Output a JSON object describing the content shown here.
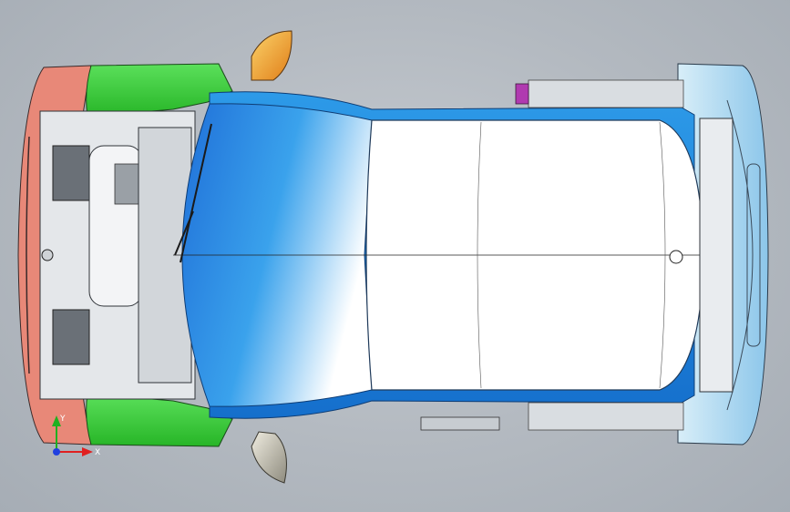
{
  "viewport": {
    "view": "top",
    "background_color": "#b3b9c0"
  },
  "model": {
    "parts": [
      {
        "part": "front-bumper",
        "color": "#e88878"
      },
      {
        "part": "front-fender-left",
        "color": "#3fcf3f"
      },
      {
        "part": "front-fender-right",
        "color": "#3fcf3f"
      },
      {
        "part": "windshield",
        "color": "#2a8be0"
      },
      {
        "part": "roof",
        "color": "#ffffff"
      },
      {
        "part": "side-sill",
        "color": "#1e86de"
      },
      {
        "part": "rear-bumper",
        "color": "#a9d7f0"
      },
      {
        "part": "mirror-left",
        "color": "#f5a23a"
      },
      {
        "part": "mirror-right",
        "color": "#c9c6b8"
      },
      {
        "part": "rear-light-accent",
        "color": "#b03ab0"
      }
    ]
  },
  "triad": {
    "axis_x_label": "X",
    "axis_y_label": "Y",
    "x_color": "#e02020",
    "y_color": "#20b020",
    "z_color": "#2040e0"
  }
}
